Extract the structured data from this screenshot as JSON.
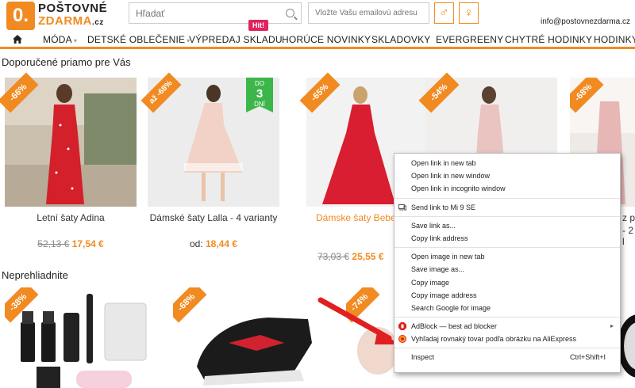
{
  "header": {
    "logo_mark": "0.",
    "logo_line1": "POŠTOVNÉ",
    "logo_line2": "ZDARMA",
    "logo_tld": ".cz",
    "search_placeholder": "Hľadať",
    "email_placeholder": "Vložte Vašu emailovú adresu",
    "male_symbol": "♂",
    "female_symbol": "♀",
    "contact_email": "info@postovnezdarma.cz"
  },
  "nav": {
    "home_icon": "home-icon",
    "hit_badge": "Hit!",
    "items": [
      {
        "label": "MÓDA",
        "caret": "▾"
      },
      {
        "label": "DETSKÉ OBLEČENIE",
        "caret": "▾"
      },
      {
        "label": "VÝPREDAJ SKLADU"
      },
      {
        "label": "HORÚCE NOVINKY"
      },
      {
        "label": "SKLADOVKY"
      },
      {
        "label": "EVERGREENY"
      },
      {
        "label": "CHYTRÉ HODINKY"
      },
      {
        "label": "HODINKY"
      }
    ]
  },
  "section1": {
    "title": "Doporučené priamo pre Vás",
    "products": [
      {
        "discount": "-66%",
        "name": "Letní šaty Adina",
        "old_price": "52,13 €",
        "new_price": "17,54 €"
      },
      {
        "discount": "až -68%",
        "name": "Dámské šaty Lalla - 4 varianty",
        "od_label": "od:",
        "new_price": "18,44 €",
        "do_label": "DO",
        "do_num": "3",
        "do_unit": "DNÍ"
      },
      {
        "discount": "-65%",
        "name": "Dámske šaty Bebe",
        "old_price": "73,03 €",
        "new_price": "25,55 €"
      },
      {
        "discount": "-54%"
      },
      {
        "discount": "-68%",
        "name_partial": "z p",
        "name_partial2": "- 2 l"
      }
    ]
  },
  "section2": {
    "title": "Neprehliadnite",
    "products": [
      {
        "discount": "-38%"
      },
      {
        "discount": "-68%"
      },
      {
        "discount": "-74%"
      }
    ]
  },
  "context_menu": {
    "groups": [
      [
        {
          "label": "Open link in new tab"
        },
        {
          "label": "Open link in new window"
        },
        {
          "label": "Open link in incognito window"
        }
      ],
      [
        {
          "label": "Send link to Mi 9 SE",
          "icon": "device-icon"
        }
      ],
      [
        {
          "label": "Save link as..."
        },
        {
          "label": "Copy link address"
        }
      ],
      [
        {
          "label": "Open image in new tab"
        },
        {
          "label": "Save image as..."
        },
        {
          "label": "Copy image"
        },
        {
          "label": "Copy image address"
        },
        {
          "label": "Search Google for image"
        }
      ],
      [
        {
          "label": "AdBlock — best ad blocker",
          "icon": "adblock-icon",
          "submenu": "▸"
        },
        {
          "label": "Vyhľadaj rovnaký tovar podľa obrázku na AliExpress",
          "icon": "aliexpress-icon"
        }
      ],
      [
        {
          "label": "Inspect",
          "shortcut": "Ctrl+Shift+I"
        }
      ]
    ]
  },
  "colors": {
    "brand_orange": "#f18a21",
    "green_badge": "#3cb64a",
    "hit_pink": "#e0245e",
    "arrow_red": "#e02020"
  }
}
